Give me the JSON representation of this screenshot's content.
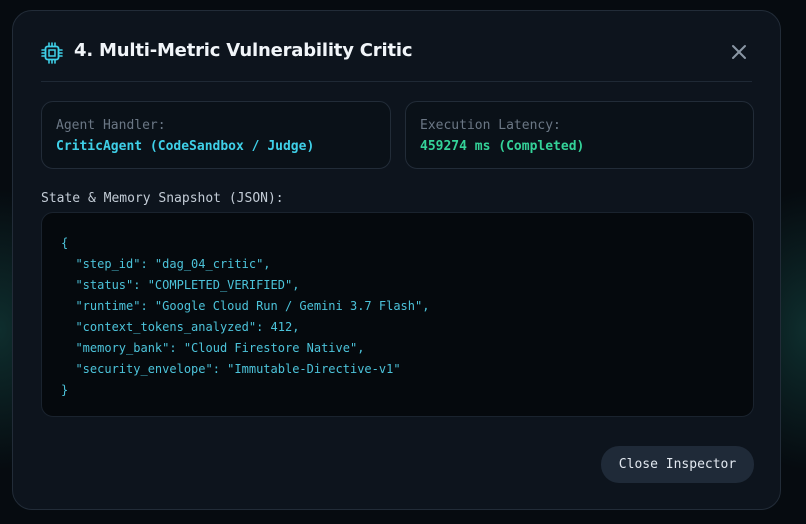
{
  "modal": {
    "title": "4. Multi-Metric Vulnerability Critic",
    "title_icon": "cpu-chip-icon",
    "close_icon": "close-icon"
  },
  "agent_handler": {
    "label": "Agent Handler:",
    "value": "CriticAgent (CodeSandbox / Judge)"
  },
  "execution_latency": {
    "label": "Execution Latency:",
    "value": "459274 ms (Completed)"
  },
  "snapshot": {
    "label": "State & Memory Snapshot (JSON):",
    "json_text": "{\n  \"step_id\": \"dag_04_critic\",\n  \"status\": \"COMPLETED_VERIFIED\",\n  \"runtime\": \"Google Cloud Run / Gemini 3.7 Flash\",\n  \"context_tokens_analyzed\": 412,\n  \"memory_bank\": \"Cloud Firestore Native\",\n  \"security_envelope\": \"Immutable-Directive-v1\"\n}"
  },
  "footer": {
    "close_label": "Close Inspector"
  },
  "colors": {
    "accent_cyan": "#3fd0e8",
    "success_green": "#34d399",
    "modal_bg": "#0d141d"
  }
}
